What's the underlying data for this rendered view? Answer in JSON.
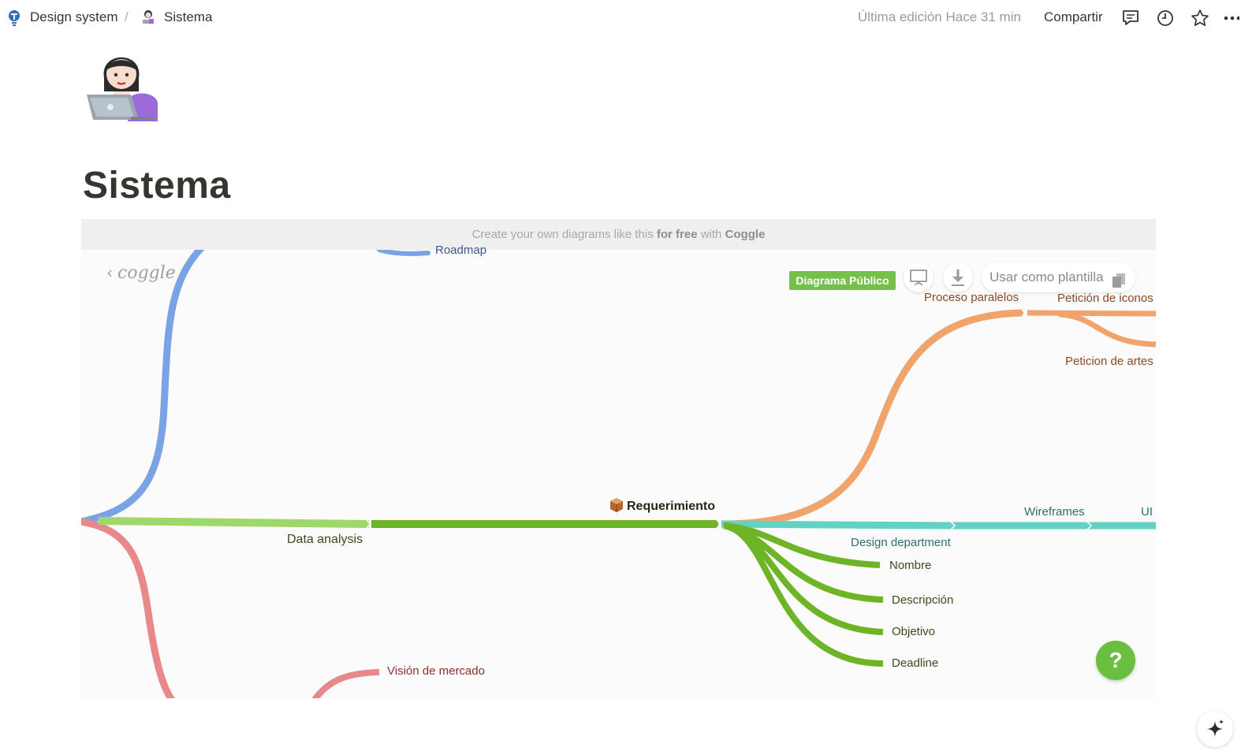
{
  "breadcrumb": {
    "workspace": "Design system",
    "separator": "/",
    "page": "Sistema"
  },
  "topbar": {
    "last_edited": "Última edición Hace 31 min",
    "share_label": "Compartir",
    "icons": [
      "comments-icon",
      "history-icon",
      "favorite-star-icon",
      "more-icon"
    ]
  },
  "page": {
    "icon": "woman-technologist-emoji",
    "title": "Sistema"
  },
  "embed": {
    "banner_prefix": "Create your own diagrams like this ",
    "banner_bold1": "for free",
    "banner_mid": " with ",
    "banner_bold2": "Coggle",
    "logo_text": "coggle",
    "public_badge": "Diagrama Público",
    "template_button": "Usar como plantilla",
    "help_label": "?"
  },
  "mindmap": {
    "central": "Requerimiento",
    "central_icon": "package-icon",
    "colors": {
      "blue": "#7aa3e5",
      "light_green": "#9fd86a",
      "green": "#6db526",
      "orange": "#f0a46c",
      "teal": "#62d3c3",
      "red": "#e8888a",
      "help": "#6abf40",
      "badge": "#74c04a"
    },
    "nodes": {
      "roadmap": "Roadmap",
      "data_analysis": "Data analysis",
      "proceso_paralelos": "Proceso paralelos",
      "peticion_iconos": "Petición de iconos",
      "peticion_artes": "Peticion de artes",
      "wireframes": "Wireframes",
      "ui": "UI",
      "design_department": "Design department",
      "nombre": "Nombre",
      "descripcion": "Descripción",
      "objetivo": "Objetivo",
      "deadline": "Deadline",
      "vision_mercado": "Visión de mercado"
    }
  }
}
